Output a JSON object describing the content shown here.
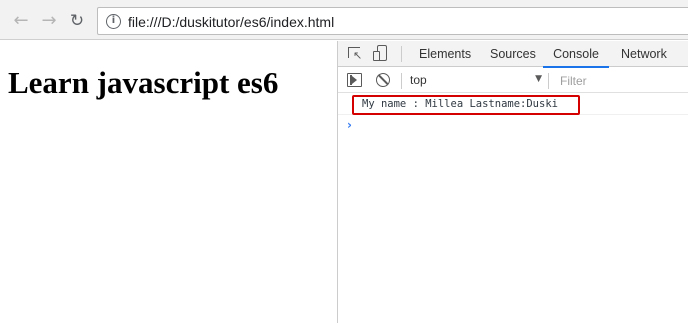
{
  "browser": {
    "back_glyph": "←",
    "forward_glyph": "→",
    "reload_glyph": "↻",
    "info_glyph": "i",
    "url": "file:///D:/duskitutor/es6/index.html"
  },
  "page": {
    "heading": "Learn javascript es6"
  },
  "devtools": {
    "tabs": {
      "elements": "Elements",
      "sources": "Sources",
      "console": "Console",
      "network": "Network"
    },
    "active_tab": "Console",
    "accent_color": "#1a73e8",
    "console_bar": {
      "context": "top",
      "caret_glyph": "▼",
      "filter_placeholder": "Filter"
    },
    "console_output": [
      {
        "text": "My name : Millea Lastname:Duski"
      }
    ],
    "prompt_glyph": "›",
    "highlight_color": "#d40000"
  },
  "icons": [
    "back-arrow-icon",
    "forward-arrow-icon",
    "reload-icon",
    "info-icon",
    "inspect-element-icon",
    "device-toolbar-icon",
    "console-sidebar-icon",
    "clear-console-icon",
    "chevron-right-icon"
  ]
}
